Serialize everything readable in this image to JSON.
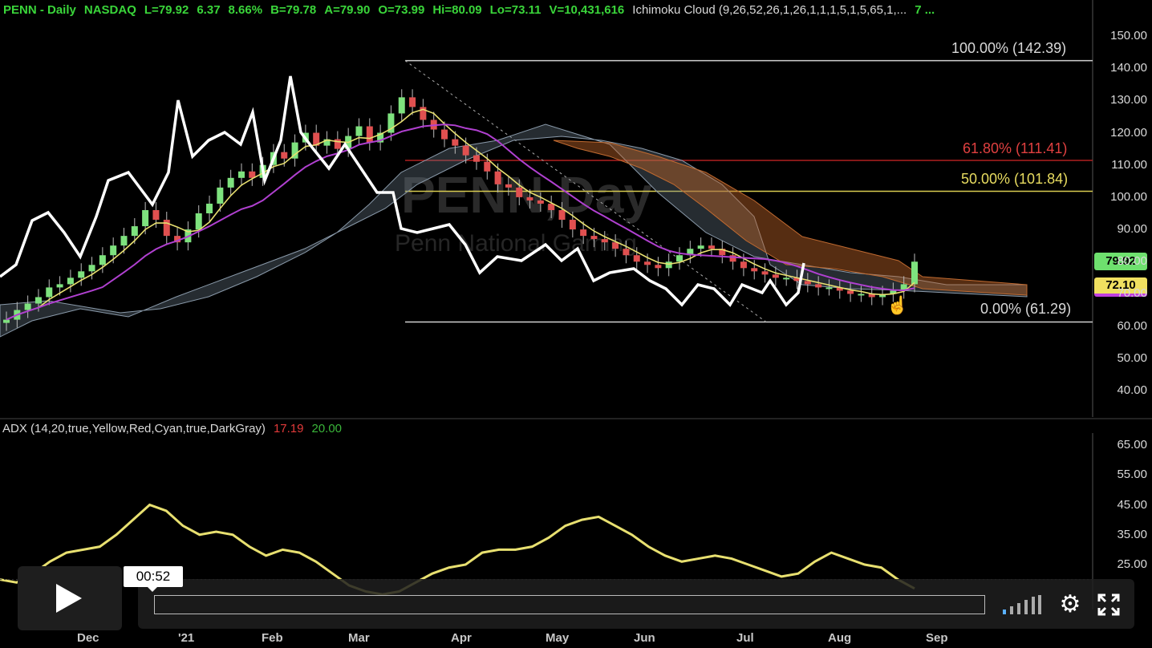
{
  "header": {
    "symbol": "PENN - Daily",
    "exchange": "NASDAQ",
    "last": "L=79.92",
    "change": "6.37",
    "change_pct": "8.66%",
    "bid": "B=79.78",
    "ask": "A=79.90",
    "open": "O=73.99",
    "high": "Hi=80.09",
    "low": "Lo=73.11",
    "volume": "V=10,431,616",
    "indicator": "Ichimoku Cloud (9,26,52,26,1,26,1,1,1,5,1,5,65,1,...",
    "overflow": "7 ..."
  },
  "watermark": {
    "line1": "PENN,Day",
    "line2": "Penn National Gaming"
  },
  "adx_header": {
    "label": "ADX (14,20,true,Yellow,Red,Cyan,true,DarkGray)",
    "value1": "17.19",
    "value2": "20.00"
  },
  "price_axis": [
    "150.00",
    "140.00",
    "130.00",
    "120.00",
    "110.00",
    "100.00",
    "90.00",
    "80.00",
    "70.00",
    "60.00",
    "50.00",
    "40.00"
  ],
  "adx_axis": [
    "65.00",
    "55.00",
    "45.00",
    "35.00",
    "25.00"
  ],
  "x_axis": [
    "Dec",
    "'21",
    "Feb",
    "Mar",
    "Apr",
    "May",
    "Jun",
    "Jul",
    "Aug",
    "Sep"
  ],
  "fib": {
    "l100": "100.00% (142.39)",
    "l618": "61.80% (111.41)",
    "l50": "50.00% (101.84)",
    "l0": "0.00% (61.29)"
  },
  "price_tags": {
    "last": "79.92",
    "ma": "72.10"
  },
  "player": {
    "time": "00:52"
  },
  "colors": {
    "up": "#7ee27e",
    "down": "#e05050",
    "tenkan": "#e8e070",
    "kijun": "#b040d0",
    "white_line": "#ffffff",
    "cloud_bull": "#8a9aaa",
    "cloud_bear": "#c06a30",
    "fib618": "#d03030",
    "fib50": "#e0d050",
    "adx": "#e8e070"
  },
  "chart_data": [
    {
      "type": "candlestick",
      "title": "PENN - Daily",
      "ylim": [
        35,
        155
      ],
      "x_categories": [
        "Dec",
        "'21",
        "Feb",
        "Mar",
        "Apr",
        "May",
        "Jun",
        "Jul",
        "Aug",
        "Sep"
      ],
      "series": [
        {
          "name": "Close (approx, per ~3 trading days)",
          "values": [
            62,
            65,
            67,
            69,
            72,
            73,
            75,
            77,
            79,
            82,
            85,
            88,
            91,
            96,
            93,
            88,
            86,
            90,
            95,
            98,
            103,
            106,
            108,
            106,
            110,
            114,
            112,
            117,
            120,
            116,
            118,
            115,
            119,
            122,
            117,
            120,
            126,
            131,
            128,
            124,
            121,
            118,
            116,
            113,
            111,
            108,
            104,
            103,
            100,
            99,
            98,
            96,
            93,
            90,
            88,
            87,
            86,
            84,
            82,
            80,
            79,
            78,
            80,
            82,
            84,
            85,
            84,
            82,
            80,
            78,
            77,
            76,
            75,
            75,
            74,
            73,
            72,
            72,
            71,
            70,
            70,
            69,
            70,
            71,
            73,
            80
          ]
        },
        {
          "name": "Fibonacci retracement",
          "levels": {
            "100%": 142.39,
            "61.8%": 111.41,
            "50%": 101.84,
            "0%": 61.29
          }
        }
      ]
    },
    {
      "type": "line",
      "title": "ADX",
      "ylim": [
        15,
        70
      ],
      "series": [
        {
          "name": "ADX",
          "values": [
            20,
            19,
            22,
            26,
            29,
            30,
            31,
            35,
            40,
            45,
            43,
            38,
            35,
            36,
            35,
            31,
            28,
            30,
            29,
            26,
            22,
            18,
            16,
            15,
            16,
            19,
            22,
            24,
            25,
            29,
            30,
            30,
            31,
            34,
            38,
            40,
            41,
            38,
            35,
            31,
            28,
            26,
            27,
            28,
            27,
            25,
            23,
            21,
            22,
            26,
            29,
            27,
            25,
            24,
            20,
            17
          ]
        }
      ]
    }
  ]
}
